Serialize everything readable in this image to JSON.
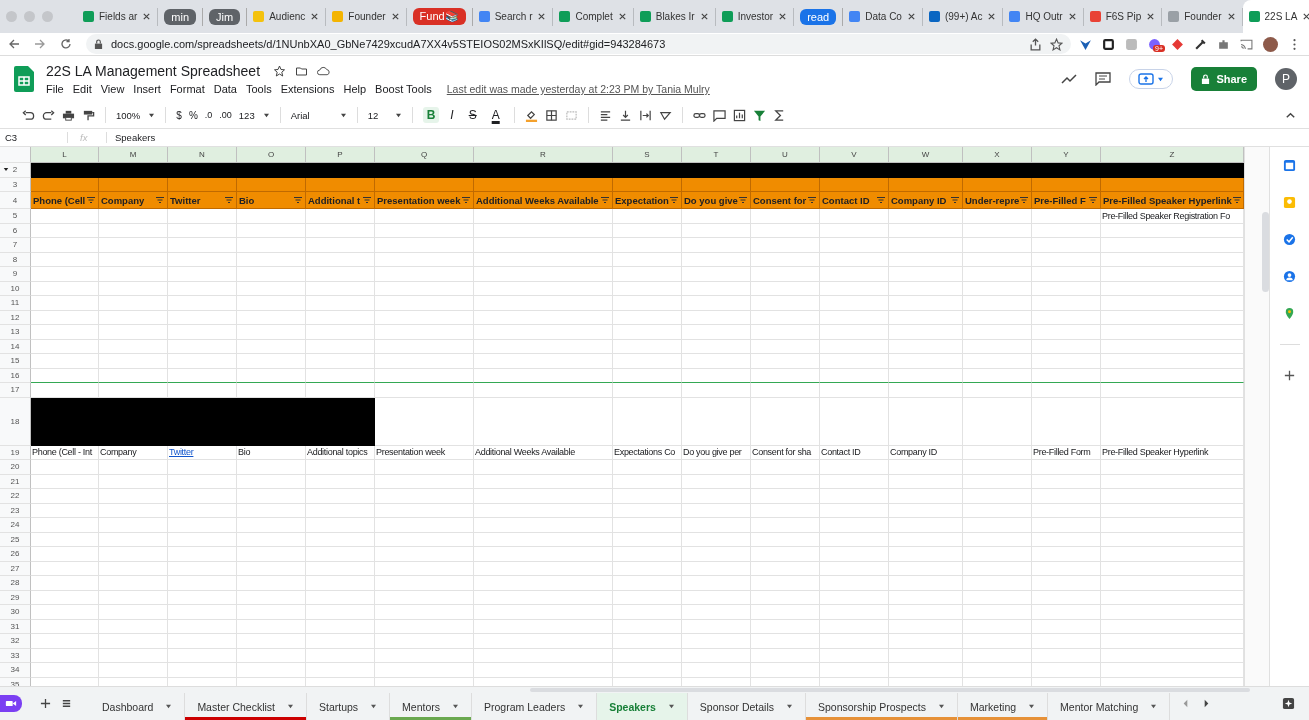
{
  "browser": {
    "tabs": [
      {
        "kind": "page",
        "title": "Fields ar",
        "active": false
      },
      {
        "kind": "group",
        "title": "min",
        "color": "#5f6368"
      },
      {
        "kind": "group",
        "title": "Jim",
        "color": "#5f6368"
      },
      {
        "kind": "page",
        "title": "Audienc",
        "active": false
      },
      {
        "kind": "page",
        "title": "Founder",
        "active": false
      },
      {
        "kind": "group",
        "title": "Fund📚",
        "color": "#d93025"
      },
      {
        "kind": "page",
        "title": "Search r",
        "active": false
      },
      {
        "kind": "page",
        "title": "Complet",
        "active": false
      },
      {
        "kind": "page",
        "title": "Blakes Ir",
        "active": false
      },
      {
        "kind": "page",
        "title": "Investor",
        "active": false
      },
      {
        "kind": "group",
        "title": "read",
        "color": "#1a73e8"
      },
      {
        "kind": "page",
        "title": "Data Co",
        "active": false
      },
      {
        "kind": "page",
        "title": "(99+) Ac",
        "active": false
      },
      {
        "kind": "page",
        "title": "HQ Outr",
        "active": false
      },
      {
        "kind": "page",
        "title": "F6S Pip",
        "active": false
      },
      {
        "kind": "page",
        "title": "Founder",
        "active": false
      },
      {
        "kind": "page",
        "title": "22S LA",
        "active": true
      }
    ],
    "url": "docs.google.com/spreadsheets/d/1NUnbXA0_GbNe7429xcudA7XX4v5STEIOS02MSxKIlSQ/edit#gid=943284673",
    "extension_badge": "9+"
  },
  "doc": {
    "title": "22S LA Management Spreadsheet",
    "menu": [
      "File",
      "Edit",
      "View",
      "Insert",
      "Format",
      "Data",
      "Tools",
      "Extensions",
      "Help",
      "Boost Tools"
    ],
    "last_edit": "Last edit was made yesterday at 2:23 PM by Tania Mulry",
    "share": "Share",
    "avatar": "P"
  },
  "toolbar": {
    "zoom": "100%",
    "currency": "$",
    "percent": "%",
    "decrease_decimal": ".0",
    "increase_decimal": ".00",
    "more_formats": "123",
    "font": "Arial",
    "font_size": "12",
    "format_buttons": [
      {
        "label": "B",
        "selected": true
      },
      {
        "label": "I",
        "selected": false
      },
      {
        "label": "S",
        "selected": false
      },
      {
        "label": "A",
        "selected": false
      }
    ]
  },
  "formula_bar": {
    "cell": "C3",
    "fx": "fx",
    "value": "Speakers"
  },
  "grid": {
    "columns": [
      "L",
      "M",
      "N",
      "O",
      "P",
      "Q",
      "R",
      "S",
      "T",
      "U",
      "V",
      "W",
      "X",
      "Y",
      "Z"
    ],
    "rows": [
      {
        "number": "2",
        "kind": "black",
        "collapsible": true
      },
      {
        "number": "3",
        "kind": "orange"
      },
      {
        "number": "4",
        "kind": "header",
        "cells": {
          "L": {
            "text": "Phone (Cell"
          },
          "M": {
            "text": "Company"
          },
          "N": {
            "text": "Twitter"
          },
          "O": {
            "text": "Bio"
          },
          "P": {
            "text": "Additional t"
          },
          "Q": {
            "text": "Presentation week"
          },
          "R": {
            "text": "Additional Weeks Available"
          },
          "S": {
            "text": "Expectation"
          },
          "T": {
            "text": "Do you give"
          },
          "U": {
            "text": "Consent for"
          },
          "V": {
            "text": "Contact ID"
          },
          "W": {
            "text": "Company ID"
          },
          "X": {
            "text": "Under-repre"
          },
          "Y": {
            "text": "Pre-Filled F"
          },
          "Z": {
            "text": "Pre-Filled Speaker Hyperlink"
          }
        }
      },
      {
        "number": "5",
        "kind": "plain",
        "cells": {
          "Z": {
            "text": "Pre-Filled Speaker Registration Fo"
          }
        }
      },
      {
        "number": "6",
        "kind": "plain"
      },
      {
        "number": "7",
        "kind": "plain"
      },
      {
        "number": "8",
        "kind": "plain"
      },
      {
        "number": "9",
        "kind": "plain"
      },
      {
        "number": "10",
        "kind": "plain"
      },
      {
        "number": "11",
        "kind": "plain"
      },
      {
        "number": "12",
        "kind": "plain"
      },
      {
        "number": "13",
        "kind": "plain"
      },
      {
        "number": "14",
        "kind": "plain"
      },
      {
        "number": "15",
        "kind": "plain"
      },
      {
        "number": "16",
        "kind": "plain",
        "range_end": true
      },
      {
        "number": "17",
        "kind": "plain"
      },
      {
        "number": "18",
        "kind": "tall"
      },
      {
        "number": "19",
        "kind": "plain",
        "cells": {
          "L": {
            "text": "Phone (Cell - Int"
          },
          "M": {
            "text": "Company"
          },
          "N": {
            "text": "Twitter",
            "link": true
          },
          "O": {
            "text": "Bio"
          },
          "P": {
            "text": "Additional topics"
          },
          "Q": {
            "text": "Presentation week"
          },
          "R": {
            "text": "Additional Weeks Available"
          },
          "S": {
            "text": "Expectations Co"
          },
          "T": {
            "text": "Do you give per"
          },
          "U": {
            "text": "Consent for sha"
          },
          "V": {
            "text": "Contact ID"
          },
          "W": {
            "text": "Company ID"
          },
          "Y": {
            "text": "Pre-Filled Form"
          },
          "Z": {
            "text": "Pre-Filled Speaker Hyperlink"
          }
        }
      },
      {
        "number": "20",
        "kind": "plain"
      },
      {
        "number": "21",
        "kind": "plain"
      },
      {
        "number": "22",
        "kind": "plain"
      },
      {
        "number": "23",
        "kind": "plain"
      },
      {
        "number": "24",
        "kind": "plain"
      },
      {
        "number": "25",
        "kind": "plain"
      },
      {
        "number": "26",
        "kind": "plain"
      },
      {
        "number": "27",
        "kind": "plain"
      },
      {
        "number": "28",
        "kind": "plain"
      },
      {
        "number": "29",
        "kind": "plain"
      },
      {
        "number": "30",
        "kind": "plain"
      },
      {
        "number": "31",
        "kind": "plain"
      },
      {
        "number": "32",
        "kind": "plain"
      },
      {
        "number": "33",
        "kind": "plain"
      },
      {
        "number": "34",
        "kind": "plain"
      },
      {
        "number": "35",
        "kind": "plain"
      }
    ]
  },
  "sheet_tabs": [
    {
      "label": "Dashboard",
      "selected": false
    },
    {
      "label": "Master Checklist",
      "selected": false,
      "color": "#cc0000"
    },
    {
      "label": "Startups",
      "selected": false
    },
    {
      "label": "Mentors",
      "selected": false,
      "color": "#6aa84f"
    },
    {
      "label": "Program Leaders",
      "selected": false
    },
    {
      "label": "Speakers",
      "selected": true
    },
    {
      "label": "Sponsor Details",
      "selected": false
    },
    {
      "label": "Sponsorship Prospects",
      "selected": false,
      "color": "#e69138"
    },
    {
      "label": "Marketing",
      "selected": false,
      "color": "#e69138"
    },
    {
      "label": "Mentor Matching",
      "selected": false
    }
  ]
}
